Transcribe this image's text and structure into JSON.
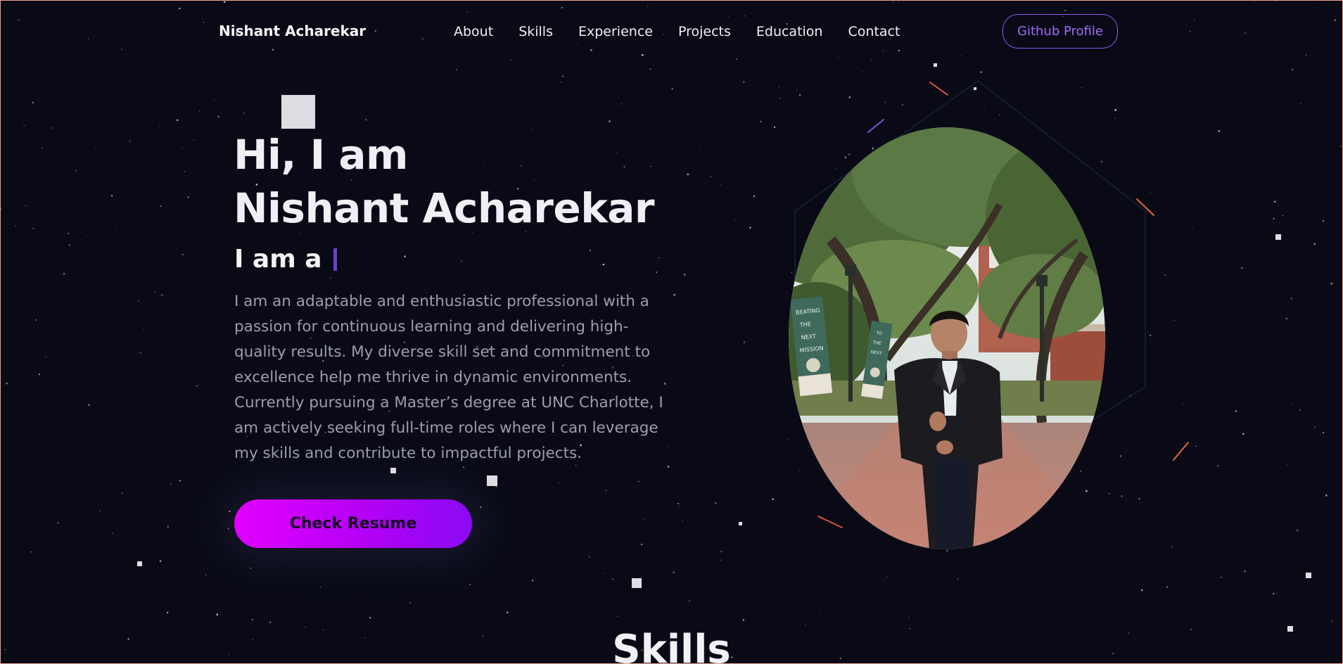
{
  "header": {
    "brand": "Nishant Acharekar",
    "nav": [
      "About",
      "Skills",
      "Experience",
      "Projects",
      "Education",
      "Contact"
    ],
    "github_button": "Github Profile"
  },
  "hero": {
    "title_line1": "Hi, I am",
    "title_line2": "Nishant Acharekar",
    "subtitle": "I am a",
    "bio": "I am an adaptable and enthusiastic professional with a passion for continuous learning and delivering high-quality results. My diverse skill set and commitment to excellence help me thrive in dynamic environments. Currently pursuing a Master’s degree at UNC Charlotte, I am actively seeking full-time roles where I can leverage my skills and contribute to impactful projects.",
    "resume_button": "Check Resume"
  },
  "portrait": {
    "banners": [
      [
        "BEATING",
        "THE",
        "NEXT",
        "MISSION"
      ],
      [
        "TO",
        "THE",
        "NEXT"
      ]
    ]
  },
  "next_section": {
    "title": "Skills"
  },
  "colors": {
    "background": "#0a0a17",
    "accent_purple": "#8b5cf6",
    "button_gradient_start": "#e100ff",
    "button_gradient_end": "#8a0bf3",
    "body_text": "#9d9ea8"
  }
}
